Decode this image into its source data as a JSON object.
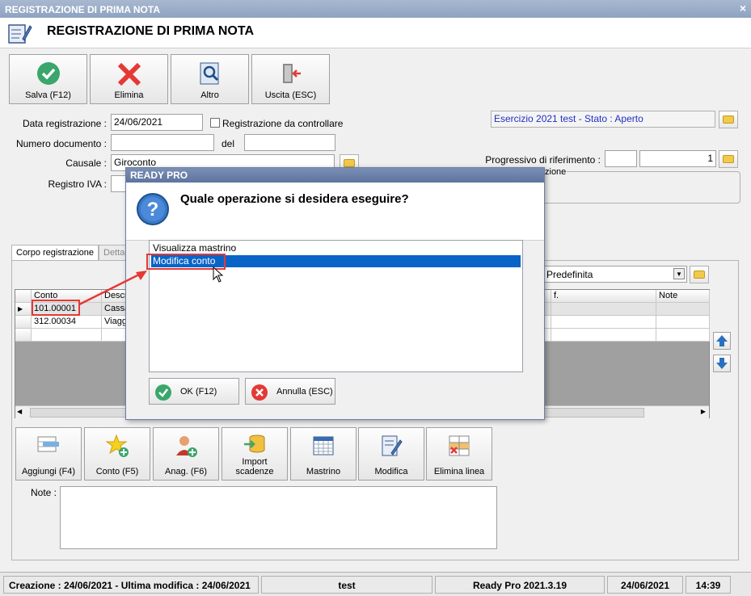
{
  "window": {
    "title": "REGISTRAZIONE DI PRIMA NOTA",
    "close": "×"
  },
  "header": {
    "title": "REGISTRAZIONE DI PRIMA NOTA"
  },
  "toolbar": {
    "save": "Salva (F12)",
    "delete": "Elimina",
    "other": "Altro",
    "exit": "Uscita (ESC)"
  },
  "form": {
    "date_label": "Data registrazione :",
    "date_value": "24/06/2021",
    "check_label": "Registrazione da controllare",
    "docnum_label": "Numero documento :",
    "docnum_value": "",
    "del_label": "del",
    "del_value": "",
    "causale_label": "Causale :",
    "causale_value": "Giroconto",
    "iva_label": "Registro IVA :",
    "esercizio": "Esercizio 2021 test - Stato : Aperto",
    "progressivo_label": "Progressivo di riferimento :",
    "progressivo_value_1": "",
    "progressivo_value_2": "1",
    "group_label_fragment": "zione"
  },
  "tabs": {
    "tab1": "Corpo registrazione",
    "tab2": "Dettag"
  },
  "grid": {
    "headers": {
      "conto": "Conto",
      "descr": "Descr",
      "rif": "f.",
      "note": "Note"
    },
    "view_select": "Predefinita",
    "rows": [
      {
        "conto": "101.00001",
        "descr": "Cassa"
      },
      {
        "conto": "312.00034",
        "descr": "Viagg"
      }
    ]
  },
  "bottom_buttons": {
    "add": "Aggiungi (F4)",
    "conto": "Conto (F5)",
    "anag": "Anag. (F6)",
    "import_1": "Import",
    "import_2": "scadenze",
    "mastrino": "Mastrino",
    "modifica": "Modifica",
    "elimina": "Elimina linea"
  },
  "note_label": "Note :",
  "status": {
    "dates": "Creazione : 24/06/2021 - Ultima modifica : 24/06/2021",
    "db": "test",
    "version": "Ready Pro 2021.3.19",
    "date": "24/06/2021",
    "time": "14:39"
  },
  "modal": {
    "title": "READY PRO",
    "question": "Quale operazione si desidera eseguire?",
    "options": [
      "Visualizza mastrino",
      "Modifica conto"
    ],
    "ok": "OK (F12)",
    "cancel": "Annulla (ESC)"
  },
  "colors": {
    "selection": "#0a64c8",
    "highlight": "#e53935",
    "save": "#3aa66b",
    "delete": "#e53935"
  }
}
